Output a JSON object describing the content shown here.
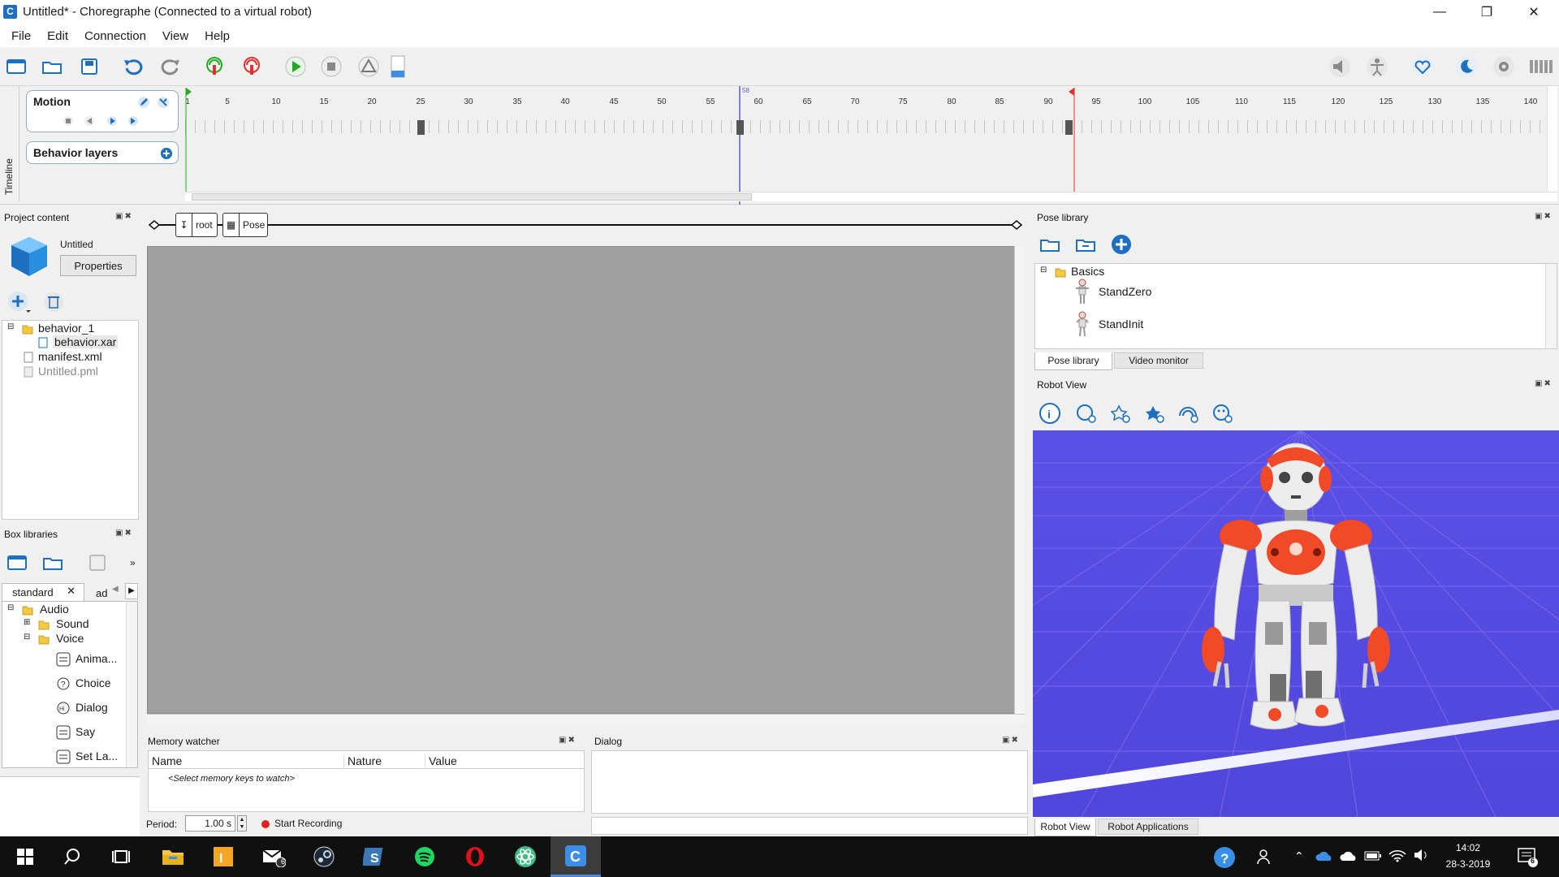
{
  "window": {
    "title": "Untitled* - Choregraphe (Connected to a virtual robot)",
    "app_icon_letter": "C"
  },
  "menu": [
    "File",
    "Edit",
    "Connection",
    "View",
    "Help"
  ],
  "timeline": {
    "tab_label": "Timeline",
    "motion_label": "Motion",
    "behavior_layers_label": "Behavior layers",
    "ruler_labels": [
      "1",
      "5",
      "10",
      "15",
      "20",
      "25",
      "30",
      "35",
      "40",
      "45",
      "50",
      "55",
      "60",
      "65",
      "70",
      "75",
      "80",
      "85",
      "90",
      "95",
      "100",
      "105",
      "110",
      "115",
      "120",
      "125",
      "130",
      "135",
      "140"
    ],
    "current_frame_label": "58"
  },
  "project_content": {
    "header": "Project content",
    "project_name": "Untitled",
    "properties_button": "Properties",
    "tree": [
      {
        "label": "behavior_1",
        "type": "folder"
      },
      {
        "label": "behavior.xar",
        "type": "file",
        "selected": true
      },
      {
        "label": "manifest.xml",
        "type": "file"
      },
      {
        "label": "Untitled.pml",
        "type": "file",
        "dim": true
      }
    ]
  },
  "flow": {
    "breadcrumb": [
      "root",
      "Pose"
    ]
  },
  "box_libraries": {
    "header": "Box libraries",
    "tabs": [
      "standard",
      "ad"
    ],
    "tree": [
      {
        "label": "Audio",
        "level": 0
      },
      {
        "label": "Sound",
        "level": 1
      },
      {
        "label": "Voice",
        "level": 1
      },
      {
        "label": "Anima...",
        "level": 2
      },
      {
        "label": "Choice",
        "level": 2
      },
      {
        "label": "Dialog",
        "level": 2
      },
      {
        "label": "Say",
        "level": 2
      },
      {
        "label": "Set La...",
        "level": 2
      }
    ]
  },
  "memory_watcher": {
    "header": "Memory watcher",
    "columns": [
      "Name",
      "Nature",
      "Value"
    ],
    "placeholder_row": "<Select memory keys to watch>",
    "period_label": "Period:",
    "period_value": "1.00 s",
    "record_label": "Start Recording"
  },
  "dialog": {
    "header": "Dialog"
  },
  "pose_library": {
    "header": "Pose library",
    "folder": "Basics",
    "items": [
      "StandZero",
      "StandInit"
    ],
    "tabs": [
      "Pose library",
      "Video monitor"
    ]
  },
  "robot_view": {
    "header": "Robot View",
    "tabs": [
      "Robot View",
      "Robot Applications"
    ],
    "bg_color": "#5a50e6",
    "robot_accent": "#f04a28"
  },
  "taskbar": {
    "time": "14:02",
    "date": "28-3-2019",
    "mail_badge": "6",
    "notif_badge": "6"
  },
  "colors": {
    "accent_blue": "#1e6fc0",
    "play_green": "#22aa22",
    "canvas_gray": "#a0a0a0",
    "record_red": "#e02020"
  }
}
